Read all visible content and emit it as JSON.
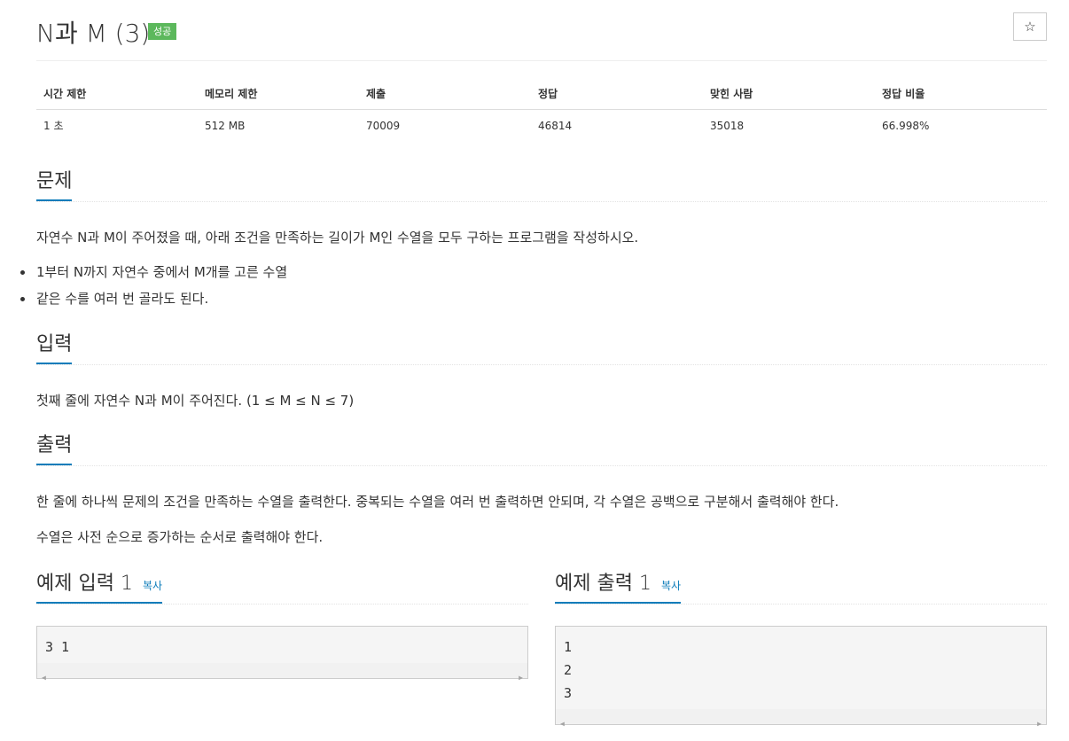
{
  "problem": {
    "title": "N과 M (3)",
    "status_badge": "성공",
    "star_icon": "☆"
  },
  "info_table": {
    "headers": [
      "시간 제한",
      "메모리 제한",
      "제출",
      "정답",
      "맞힌 사람",
      "정답 비율"
    ],
    "values": [
      "1 초",
      "512 MB",
      "70009",
      "46814",
      "35018",
      "66.998%"
    ]
  },
  "sections": {
    "description": {
      "title": "문제",
      "text": "자연수 N과 M이 주어졌을 때, 아래 조건을 만족하는 길이가 M인 수열을 모두 구하는 프로그램을 작성하시오.",
      "conditions": [
        "1부터 N까지 자연수 중에서 M개를 고른 수열",
        "같은 수를 여러 번 골라도 된다."
      ]
    },
    "input": {
      "title": "입력",
      "text": "첫째 줄에 자연수 N과 M이 주어진다. (1 ≤ M ≤ N ≤ 7)"
    },
    "output": {
      "title": "출력",
      "text1": "한 줄에 하나씩 문제의 조건을 만족하는 수열을 출력한다. 중복되는 수열을 여러 번 출력하면 안되며, 각 수열은 공백으로 구분해서 출력해야 한다.",
      "text2": "수열은 사전 순으로 증가하는 순서로 출력해야 한다."
    }
  },
  "samples": {
    "input": {
      "title": "예제 입력 1",
      "copy_label": "복사",
      "lines": [
        "3 1"
      ]
    },
    "output": {
      "title": "예제 출력 1",
      "copy_label": "복사",
      "lines": [
        "1",
        "2",
        "3"
      ]
    }
  },
  "colors": {
    "accent": "#0c7cba",
    "badge": "#5cb85c"
  }
}
